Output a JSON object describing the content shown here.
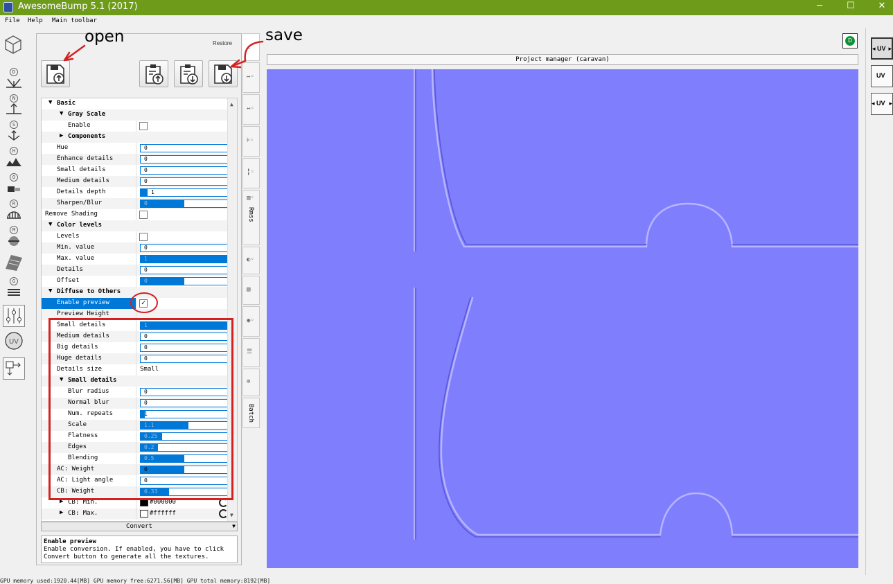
{
  "app": {
    "title": "AwesomeBump 5.1 (2017)",
    "minimize": "─",
    "maximize": "☐",
    "close": "✕"
  },
  "menu": [
    "File",
    "Help",
    "Main toolbar"
  ],
  "annotations": {
    "open": "open",
    "save": "save"
  },
  "panel": {
    "restore": "Restore",
    "convert": "Convert"
  },
  "left_tools": [
    {
      "badge": "D",
      "icon": "cube-icon"
    },
    {
      "badge": "D",
      "icon": "diffuse-icon"
    },
    {
      "badge": "N",
      "icon": "normal-icon"
    },
    {
      "badge": "S",
      "icon": "specular-icon"
    },
    {
      "badge": "H",
      "icon": "height-icon"
    },
    {
      "badge": "O",
      "icon": "occlusion-icon"
    },
    {
      "badge": "R",
      "icon": "roughness-icon"
    },
    {
      "badge": "M",
      "icon": "metallic-icon"
    },
    {
      "badge": "",
      "icon": "grunge-icon"
    },
    {
      "badge": "G",
      "icon": "layers-icon"
    },
    {
      "badge": "",
      "icon": "settings-sliders-icon"
    },
    {
      "badge": "UV",
      "icon": "uv-icon"
    },
    {
      "badge": "",
      "icon": "export-icon"
    }
  ],
  "props": {
    "basic": "Basic",
    "gray_scale": "Gray Scale",
    "enable": "Enable",
    "components": "Components",
    "hue": {
      "label": "Hue",
      "value": "0"
    },
    "enhance_details": {
      "label": "Enhance details",
      "value": "0"
    },
    "small_details": {
      "label": "Small details",
      "value": "0"
    },
    "medium_details": {
      "label": "Medium details",
      "value": "0"
    },
    "details_depth": {
      "label": "Details depth",
      "value": "1",
      "fill": 0.08
    },
    "sharpen_blur": {
      "label": "Sharpen/Blur",
      "value": "0",
      "fill": 0.5
    },
    "remove_shading": "Remove Shading",
    "color_levels": "Color levels",
    "levels": "Levels",
    "min_value": {
      "label": "Min. value",
      "value": "0"
    },
    "max_value": {
      "label": "Max. value",
      "value": "1",
      "fill": 1.0
    },
    "details": {
      "label": "Details",
      "value": "0"
    },
    "offset": {
      "label": "Offset",
      "value": "0",
      "fill": 0.5
    },
    "diffuse_to_others": "Diffuse to Others",
    "enable_preview": {
      "label": "Enable preview",
      "checked": "✓"
    },
    "preview_height": "Preview Height",
    "dto_small": {
      "label": "Small details",
      "value": "1",
      "fill": 1.0
    },
    "dto_medium": {
      "label": "Medium details",
      "value": "0"
    },
    "dto_big": {
      "label": "Big details",
      "value": "0"
    },
    "dto_huge": {
      "label": "Huge details",
      "value": "0"
    },
    "details_size": {
      "label": "Details size",
      "value": "Small"
    },
    "small_group": "Small details",
    "blur_radius": {
      "label": "Blur radius",
      "value": "0"
    },
    "normal_blur": {
      "label": "Normal blur",
      "value": "0"
    },
    "num_repeats": {
      "label": "Num. repeats",
      "value": "1",
      "fill": 0.05
    },
    "scale": {
      "label": "Scale",
      "value": "1.1",
      "fill": 0.55
    },
    "flatness": {
      "label": "Flatness",
      "value": "0.25",
      "fill": 0.25
    },
    "edges": {
      "label": "Edges",
      "value": "0.2",
      "fill": 0.2
    },
    "blending": {
      "label": "Blending",
      "value": "0.5",
      "fill": 0.5
    },
    "ac_weight": {
      "label": "AC: Weight",
      "value": "0",
      "fill": 0.5
    },
    "ac_light_angle": {
      "label": "AC: Light angle",
      "value": "0"
    },
    "cb_weight": {
      "label": "CB: Weight",
      "value": "0.33",
      "fill": 0.33
    },
    "cb_min": {
      "label": "CB: Min.",
      "value": "#000000"
    },
    "cb_max": {
      "label": "CB: Max.",
      "value": "#ffffff"
    }
  },
  "help": {
    "title": "Enable preview",
    "text": "Enable conversion. If enabled, you have to click Convert button to generate all the textures."
  },
  "vtabs": {
    "rmss": "Rmss",
    "batch": "Batch"
  },
  "project_manager": "Project manager (caravan)",
  "d_badge": "D",
  "right_tools": [
    "UV",
    "UV",
    "UV"
  ],
  "status": "GPU memory used:1920.44[MB] GPU memory free:6271.56[MB] GPU total memory:8192[MB]",
  "colors": {
    "titlebar": "#6f9b1b",
    "viewport": "#7f7ffe",
    "selection": "#0078d7",
    "annotation_red": "#d52020"
  }
}
